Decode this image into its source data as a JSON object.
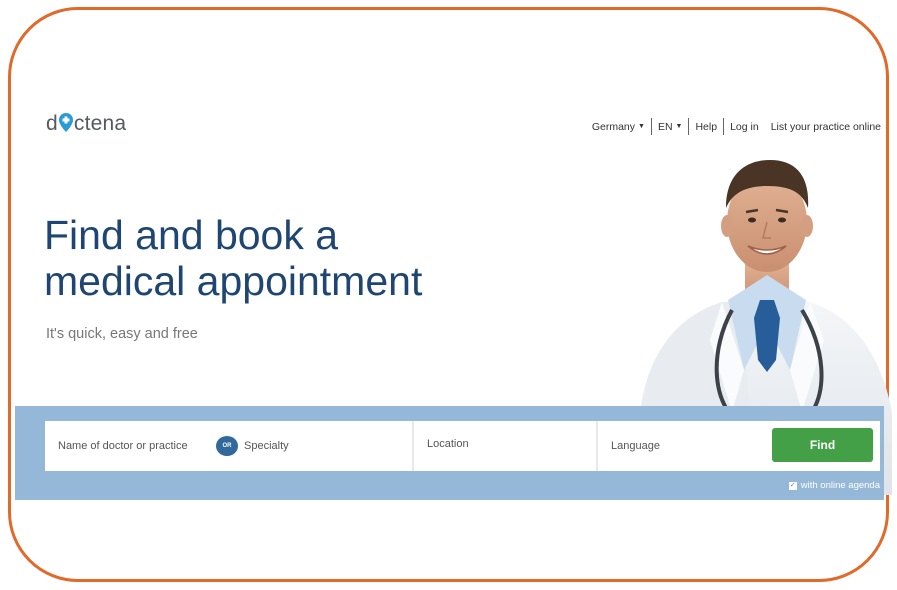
{
  "brand": {
    "logo_before": "d",
    "logo_after": "ctena",
    "pin_color": "#2a9bd7"
  },
  "topnav": {
    "country": "Germany",
    "language": "EN",
    "help": "Help",
    "login": "Log in",
    "list_practice": "List your practice online"
  },
  "hero": {
    "headline_line1": "Find and book a",
    "headline_line2": "medical appointment",
    "tagline": "It's quick, easy and free"
  },
  "search": {
    "name_placeholder": "Name of doctor or practice",
    "or_label": "OR",
    "specialty_placeholder": "Specialty",
    "location_placeholder": "Location",
    "language_placeholder": "Language",
    "find_label": "Find",
    "agenda_label": "with online agenda",
    "agenda_checked": true
  },
  "colors": {
    "frame": "#e1692a",
    "headline": "#1f4672",
    "band": "#96b8d8",
    "find_button": "#43a047",
    "or_badge": "#31699c"
  }
}
